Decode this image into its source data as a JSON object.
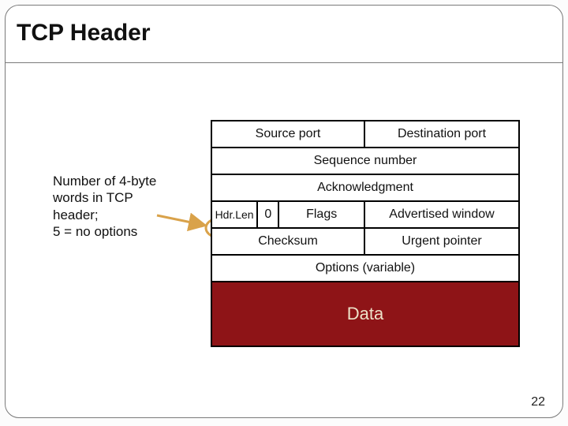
{
  "title": "TCP Header",
  "page_number": "22",
  "annotation": "Number of 4-byte words in TCP header;\n5 = no options",
  "header_rows": {
    "r1": {
      "source_port": "Source port",
      "dest_port": "Destination port"
    },
    "r2": {
      "sequence": "Sequence number"
    },
    "r3": {
      "ack": "Acknowledgment"
    },
    "r4": {
      "hdrlen": "Hdr.Len",
      "zero": "0",
      "flags": "Flags",
      "adv_window": "Advertised window"
    },
    "r5": {
      "checksum": "Checksum",
      "urgent": "Urgent pointer"
    },
    "r6": {
      "options": "Options (variable)"
    },
    "r7": {
      "data": "Data"
    }
  },
  "colors": {
    "data_bg": "#8e1417",
    "data_fg": "#eee2c9",
    "callout": "#d9a24a"
  }
}
